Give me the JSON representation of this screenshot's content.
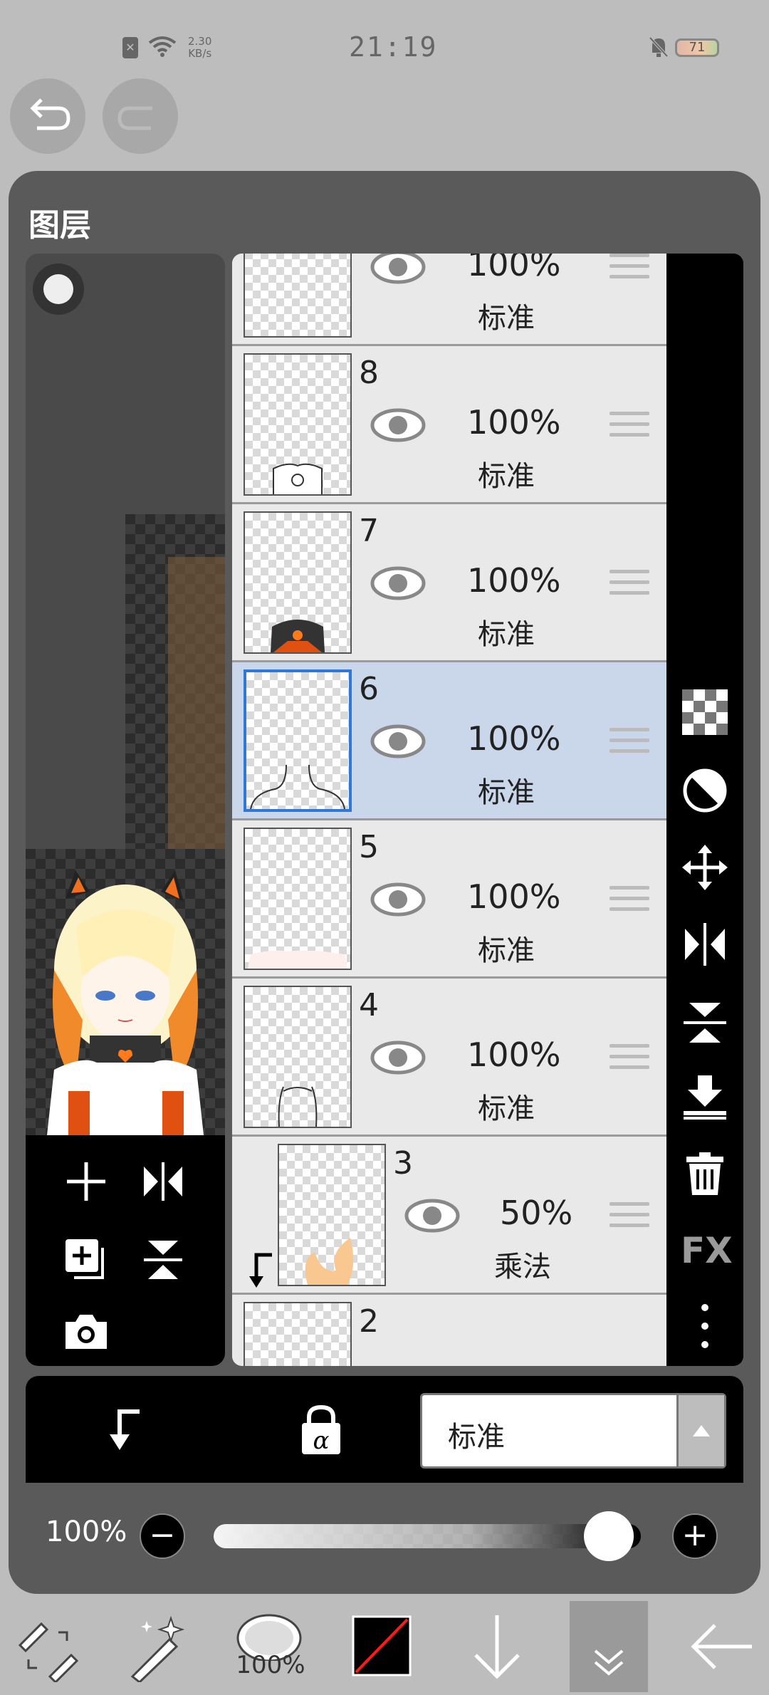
{
  "status_bar": {
    "time": "21:19",
    "net_speed_value": "2.30",
    "net_speed_unit": "KB/s",
    "battery": "71",
    "sim_icon": "sim-x-icon",
    "wifi_icon": "wifi-icon",
    "mute_icon": "bell-mute-icon"
  },
  "panel": {
    "title": "图层"
  },
  "layers": [
    {
      "num": "",
      "opacity": "100%",
      "blend": "标准",
      "selected": false
    },
    {
      "num": "8",
      "opacity": "100%",
      "blend": "标准",
      "selected": false
    },
    {
      "num": "7",
      "opacity": "100%",
      "blend": "标准",
      "selected": false
    },
    {
      "num": "6",
      "opacity": "100%",
      "blend": "标准",
      "selected": true
    },
    {
      "num": "5",
      "opacity": "100%",
      "blend": "标准",
      "selected": false
    },
    {
      "num": "4",
      "opacity": "100%",
      "blend": "标准",
      "selected": false
    },
    {
      "num": "3",
      "opacity": "50%",
      "blend": "乘法",
      "selected": false,
      "clipped": true
    },
    {
      "num": "2",
      "opacity": "",
      "blend": "",
      "selected": false
    }
  ],
  "right_tools": {
    "fx_label": "FX",
    "icons": [
      "checker-icon",
      "circle-half-icon",
      "move-icon",
      "flip-h-icon",
      "flip-v-icon",
      "merge-down-icon",
      "trash-icon",
      "fx-icon",
      "more-icon"
    ]
  },
  "bottom_panel": {
    "blend_mode": "标准",
    "opacity_label": "100%",
    "opacity_value": 1.0,
    "minus": "−",
    "plus": "+"
  },
  "toolbar": {
    "brush_size": "100%",
    "color_primary": "#000000",
    "color_secondary": "#ff0000"
  }
}
